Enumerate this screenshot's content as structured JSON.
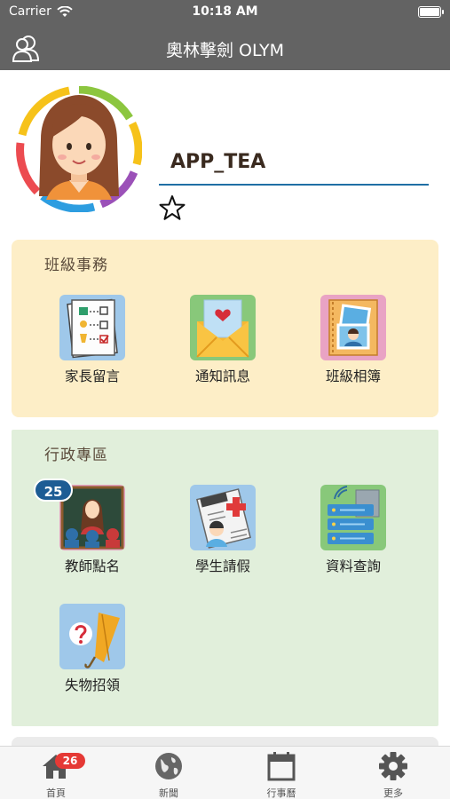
{
  "status_bar": {
    "carrier": "Carrier",
    "time": "10:18 AM"
  },
  "nav": {
    "title": "奧林擊劍 OLYM"
  },
  "profile": {
    "username": "APP_TEA"
  },
  "sections": {
    "class": {
      "title": "班級事務",
      "items": [
        {
          "label": "家長留言",
          "icon": "checklist-icon"
        },
        {
          "label": "通知訊息",
          "icon": "envelope-heart-icon"
        },
        {
          "label": "班級相簿",
          "icon": "photo-album-icon"
        }
      ]
    },
    "admin": {
      "title": "行政專區",
      "items": [
        {
          "label": "教師點名",
          "icon": "classroom-icon",
          "badge": "25"
        },
        {
          "label": "學生請假",
          "icon": "leave-form-icon"
        },
        {
          "label": "資料查詢",
          "icon": "server-icon"
        },
        {
          "label": "失物招領",
          "icon": "lost-umbrella-icon"
        }
      ]
    }
  },
  "tabbar": {
    "items": [
      {
        "label": "首頁",
        "badge": "26",
        "icon": "home-icon"
      },
      {
        "label": "新聞",
        "icon": "globe-icon"
      },
      {
        "label": "行事曆",
        "icon": "calendar-icon"
      },
      {
        "label": "更多",
        "icon": "gear-icon"
      }
    ]
  },
  "colors": {
    "header_bg": "#636363",
    "class_section_bg": "#fdeec7",
    "admin_section_bg": "#e1efdb",
    "accent_line": "#1f6fa5",
    "badge_blue": "#1d5c94",
    "badge_red": "#e53935"
  }
}
